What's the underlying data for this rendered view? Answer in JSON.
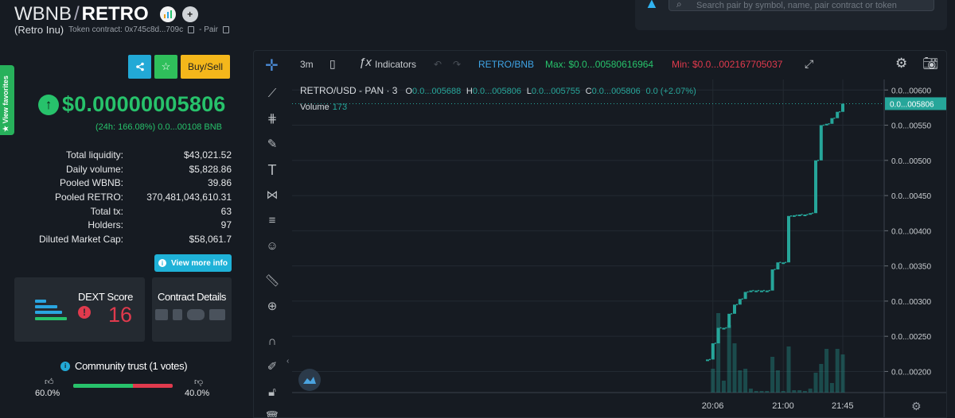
{
  "header": {
    "base_symbol": "WBNB",
    "separator": "/",
    "quote_symbol": "RETRO",
    "token_name": "(Retro Inu)",
    "token_contract_label": "Token contract: 0x745c8d...709c",
    "pair_label": "- Pair"
  },
  "search": {
    "placeholder": "Search pair by symbol, name, pair contract or token"
  },
  "favorites": {
    "label": "★ View favorites"
  },
  "actions": {
    "share_icon": "share-icon",
    "star_icon": "star-icon",
    "buy_sell": "Buy/Sell"
  },
  "price": {
    "value": "$0.00000005806",
    "change_24h": "(24h: 166.08%) 0.0...00108 BNB"
  },
  "stats": [
    {
      "label": "Total liquidity:",
      "value": "$43,021.52"
    },
    {
      "label": "Daily volume:",
      "value": "$5,828.86"
    },
    {
      "label": "Pooled WBNB:",
      "value": "39.86"
    },
    {
      "label": "Pooled RETRO:",
      "value": "370,481,043,610.31"
    },
    {
      "label": "Total tx:",
      "value": "63"
    },
    {
      "label": "Holders:",
      "value": "97"
    },
    {
      "label": "Diluted Market Cap:",
      "value": "$58,061.7"
    }
  ],
  "more_info": {
    "label": "View more info"
  },
  "dext_score": {
    "title": "DEXT Score",
    "value": "16"
  },
  "contract_details": {
    "title": "Contract Details"
  },
  "community_trust": {
    "title": "Community trust (1 votes)",
    "positive_pct": "60.0%",
    "negative_pct": "40.0%",
    "positive_fraction": 0.6
  },
  "chart_toolbar": {
    "interval": "3m",
    "indicators": "Indicators",
    "pair": "RETRO/BNB",
    "max_label": "Max: $0.0...00580616964",
    "min_label": "Min: $0.0...002167705037"
  },
  "legend": {
    "symbol": "RETRO/USD - PAN · 3",
    "o_label": "O",
    "o_value": "0.0...005688",
    "h_label": "H",
    "h_value": "0.0...005806",
    "l_label": "L",
    "l_value": "0.0...005755",
    "c_label": "C",
    "c_value": "0.0...005806",
    "change": "0.0 (+2.07%)",
    "volume_label": "Volume",
    "volume_value": "173"
  },
  "colors": {
    "up": "#26a69a",
    "green": "#27c26b",
    "red": "#e03a4d",
    "accent": "#22a9d6"
  },
  "chart_data": {
    "type": "candlestick",
    "x_ticks": [
      "20:06",
      "21:00",
      "21:45"
    ],
    "y_ticks": [
      "0.0...00600",
      "0.0...00550",
      "0.0...00500",
      "0.0...00450",
      "0.0...00400",
      "0.0...00350",
      "0.0...00300",
      "0.0...00250",
      "0.0...00200"
    ],
    "ylim": [
      1.7e-08,
      6.15e-08
    ],
    "last_price_label": "0.0...005806",
    "last_price": 5.806e-08,
    "candles": [
      {
        "o": 2.17,
        "c": 2.17,
        "v": 0
      },
      {
        "o": 2.17,
        "c": 2.4,
        "v": 0.3
      },
      {
        "o": 2.4,
        "c": 2.62,
        "v": 1.0
      },
      {
        "o": 2.62,
        "c": 2.62,
        "v": 0.15
      },
      {
        "o": 2.62,
        "c": 2.82,
        "v": 0.85
      },
      {
        "o": 2.82,
        "c": 2.95,
        "v": 0.62
      },
      {
        "o": 2.95,
        "c": 3.03,
        "v": 0.28
      },
      {
        "o": 3.03,
        "c": 3.13,
        "v": 0.3
      },
      {
        "o": 3.13,
        "c": 3.15,
        "v": 0.05
      },
      {
        "o": 3.15,
        "c": 3.15,
        "v": 0.02
      },
      {
        "o": 3.15,
        "c": 3.15,
        "v": 0.02
      },
      {
        "o": 3.15,
        "c": 3.15,
        "v": 0.02
      },
      {
        "o": 3.15,
        "c": 3.45,
        "v": 0.45
      },
      {
        "o": 3.45,
        "c": 3.55,
        "v": 0.28
      },
      {
        "o": 3.55,
        "c": 3.55,
        "v": 0.02
      },
      {
        "o": 3.55,
        "c": 4.21,
        "v": 0.58
      },
      {
        "o": 4.21,
        "c": 4.22,
        "v": 0.03
      },
      {
        "o": 4.22,
        "c": 4.23,
        "v": 0.03
      },
      {
        "o": 4.23,
        "c": 4.23,
        "v": 0.02
      },
      {
        "o": 4.23,
        "c": 4.25,
        "v": 0.05
      },
      {
        "o": 4.25,
        "c": 5.0,
        "v": 0.25
      },
      {
        "o": 5.0,
        "c": 5.5,
        "v": 0.36
      },
      {
        "o": 5.5,
        "c": 5.52,
        "v": 0.55
      },
      {
        "o": 5.52,
        "c": 5.6,
        "v": 0.12
      },
      {
        "o": 5.6,
        "c": 5.69,
        "v": 0.55
      },
      {
        "o": 5.69,
        "c": 5.806,
        "v": 0.48
      }
    ]
  }
}
